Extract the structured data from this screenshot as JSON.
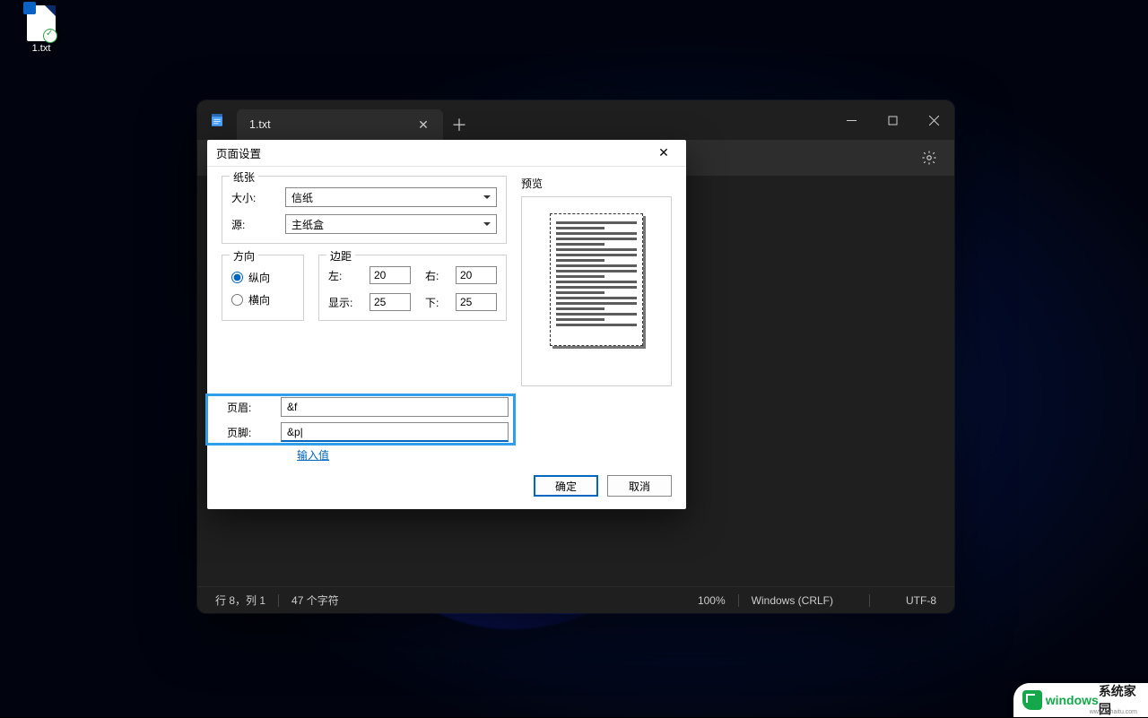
{
  "desktop": {
    "file_label": "1.txt"
  },
  "notepad": {
    "tab_name": "1.txt",
    "status": {
      "position": "行 8，列 1",
      "chars": "47 个字符",
      "zoom": "100%",
      "eol": "Windows (CRLF)",
      "encoding": "UTF-8"
    }
  },
  "dialog": {
    "title": "页面设置",
    "paper": {
      "legend": "纸张",
      "size_label": "大小:",
      "size_value": "信纸",
      "source_label": "源:",
      "source_value": "主纸盒"
    },
    "orientation": {
      "legend": "方向",
      "portrait": "纵向",
      "landscape": "横向",
      "selected": "portrait"
    },
    "margins": {
      "legend": "边距",
      "left_label": "左:",
      "left_value": "20",
      "right_label": "右:",
      "right_value": "20",
      "top_label": "显示:",
      "top_value": "25",
      "bottom_label": "下:",
      "bottom_value": "25"
    },
    "preview_label": "预览",
    "header_label": "页眉:",
    "header_value": "&f",
    "footer_label": "页脚:",
    "footer_value": "&p|",
    "help_link": "输入值",
    "ok": "确定",
    "cancel": "取消"
  },
  "watermark": {
    "brand": "windows",
    "suffix": "系统家园",
    "url": "www.ruhaitu.com"
  }
}
